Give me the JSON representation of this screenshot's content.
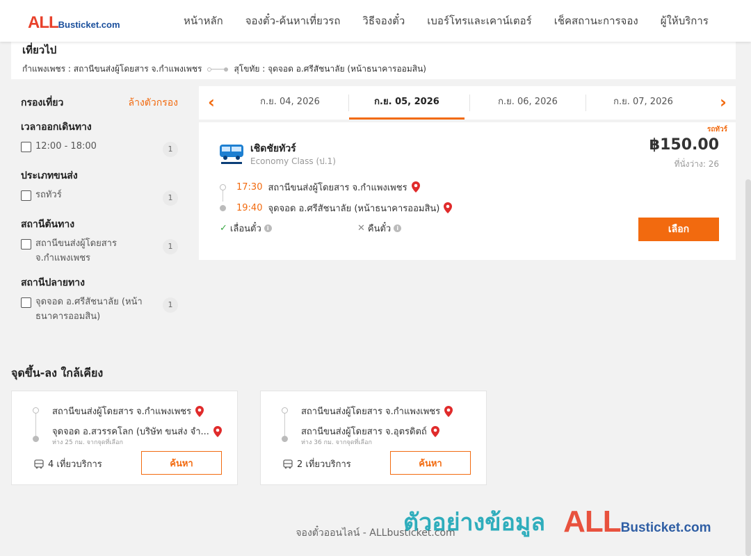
{
  "header": {
    "logo_big": "ALL",
    "logo_small": "Busticket.com",
    "nav": [
      "หน้าหลัก",
      "จองตั๋ว-ค้นหาเที่ยวรถ",
      "วิธีจองตั๋ว",
      "เบอร์โทรและเคาน์เตอร์",
      "เช็คสถานะการจอง",
      "ผู้ให้บริการ"
    ]
  },
  "trip": {
    "title": "เที่ยวไป",
    "from": "กำแพงเพชร : สถานีขนส่งผู้โดยสาร จ.กำแพงเพชร",
    "to": "สุโขทัย : จุดจอด อ.ศรีสัชนาลัย (หน้าธนาคารออมสิน)"
  },
  "filter": {
    "title": "กรองเที่ยว",
    "clear_label": "ล้างตัวกรอง",
    "groups": [
      {
        "title": "เวลาออกเดินทาง",
        "label": "12:00 - 18:00",
        "count": "1"
      },
      {
        "title": "ประเภทขนส่ง",
        "label": "รถทัวร์",
        "count": "1"
      },
      {
        "title": "สถานีต้นทาง",
        "label": "สถานีขนส่งผู้โดยสาร จ.กำแพงเพชร",
        "count": "1"
      },
      {
        "title": "สถานีปลายทาง",
        "label": "จุดจอด อ.ศรีสัชนาลัย (หน้าธนาคารออมสิน)",
        "count": "1"
      }
    ]
  },
  "dates": {
    "tabs": [
      "ก.ย. 04, 2026",
      "ก.ย. 05, 2026",
      "ก.ย. 06, 2026",
      "ก.ย. 07, 2026"
    ],
    "active_index": 1
  },
  "result": {
    "tag": "รถทัวร์",
    "operator": "เชิดชัยทัวร์",
    "bus_class": "Economy Class (ป.1)",
    "price": "฿150.00",
    "seats": "ที่นั่งว่าง: 26",
    "depart_time": "17:30",
    "depart_place": "สถานีขนส่งผู้โดยสาร จ.กำแพงเพชร",
    "arrive_time": "19:40",
    "arrive_place": "จุดจอด อ.ศรีสัชนาลัย (หน้าธนาคารออมสิน)",
    "policy_postpone": "เลื่อนตั๋ว",
    "policy_refund": "คืนตั๋ว",
    "select_label": "เลือก"
  },
  "nearby": {
    "title": "จุดขึ้น-ลง ใกล้เคียง",
    "cards": [
      {
        "from": "สถานีขนส่งผู้โดยสาร จ.กำแพงเพชร",
        "to": "จุดจอด อ.สวรรคโลก (บริษัท ขนส่ง จำ...",
        "distance": "ห่าง 25 กม. จากจุดที่เลือก",
        "trips": "4 เที่ยวบริการ",
        "button": "ค้นหา"
      },
      {
        "from": "สถานีขนส่งผู้โดยสาร จ.กำแพงเพชร",
        "to": "สถานีขนส่งผู้โดยสาร จ.อุตรดิตถ์",
        "distance": "ห่าง 36 กม. จากจุดที่เลือก",
        "trips": "2 เที่ยวบริการ",
        "button": "ค้นหา"
      }
    ]
  },
  "footer": {
    "text": "จองตั๋วออนไลน์ - ALLbusticket.com",
    "watermark_text": "ตัวอย่างข้อมูล",
    "watermark_logo_big": "ALL",
    "watermark_logo_small": "Busticket.com"
  },
  "colors": {
    "accent": "#f26a0f",
    "pin": "#e02b2b",
    "watermark": "#1aa6b7"
  }
}
